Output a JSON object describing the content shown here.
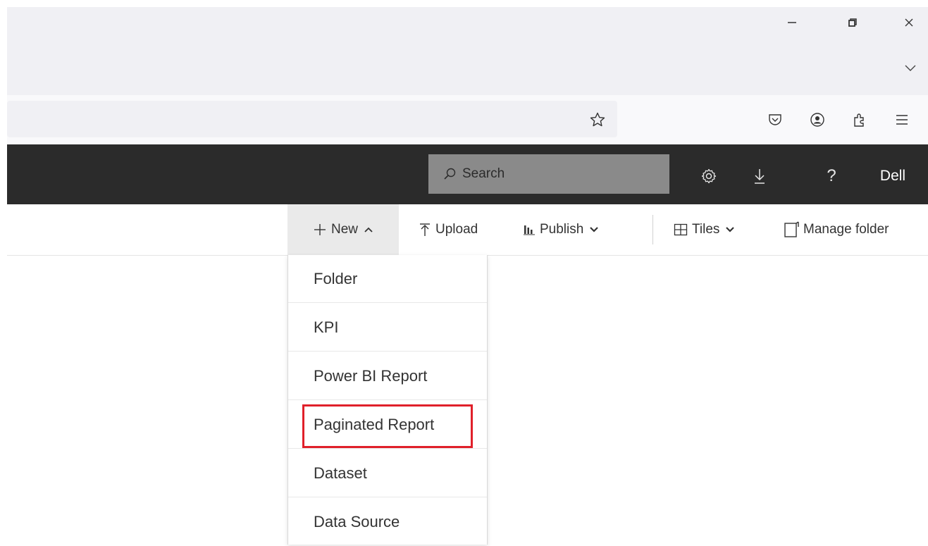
{
  "browser": {
    "window_controls": {
      "minimize_icon": "minimize-icon",
      "restore_icon": "restore-icon",
      "close_icon": "close-icon"
    },
    "tabs_dropdown_icon": "chevron-down-icon",
    "toolbar_icons": [
      "bookmark-star-icon",
      "pocket-icon",
      "account-icon",
      "extensions-icon",
      "menu-icon"
    ]
  },
  "header": {
    "search_placeholder": "Search",
    "user_name": "Dell",
    "icons": [
      "settings-icon",
      "download-icon",
      "help-icon"
    ]
  },
  "toolbar": {
    "new_label": "New",
    "upload_label": "Upload",
    "publish_label": "Publish",
    "tiles_label": "Tiles",
    "manage_folder_label": "Manage folder"
  },
  "new_menu": {
    "items": [
      {
        "label": "Folder"
      },
      {
        "label": "KPI"
      },
      {
        "label": "Power BI Report"
      },
      {
        "label": "Paginated Report",
        "highlighted": true
      },
      {
        "label": "Dataset"
      },
      {
        "label": "Data Source"
      }
    ]
  },
  "colors": {
    "dark_bar": "#2b2b2b",
    "search_bg": "#8a8a8a",
    "highlight": "#e0202a",
    "new_button_bg": "#eaeaea"
  }
}
